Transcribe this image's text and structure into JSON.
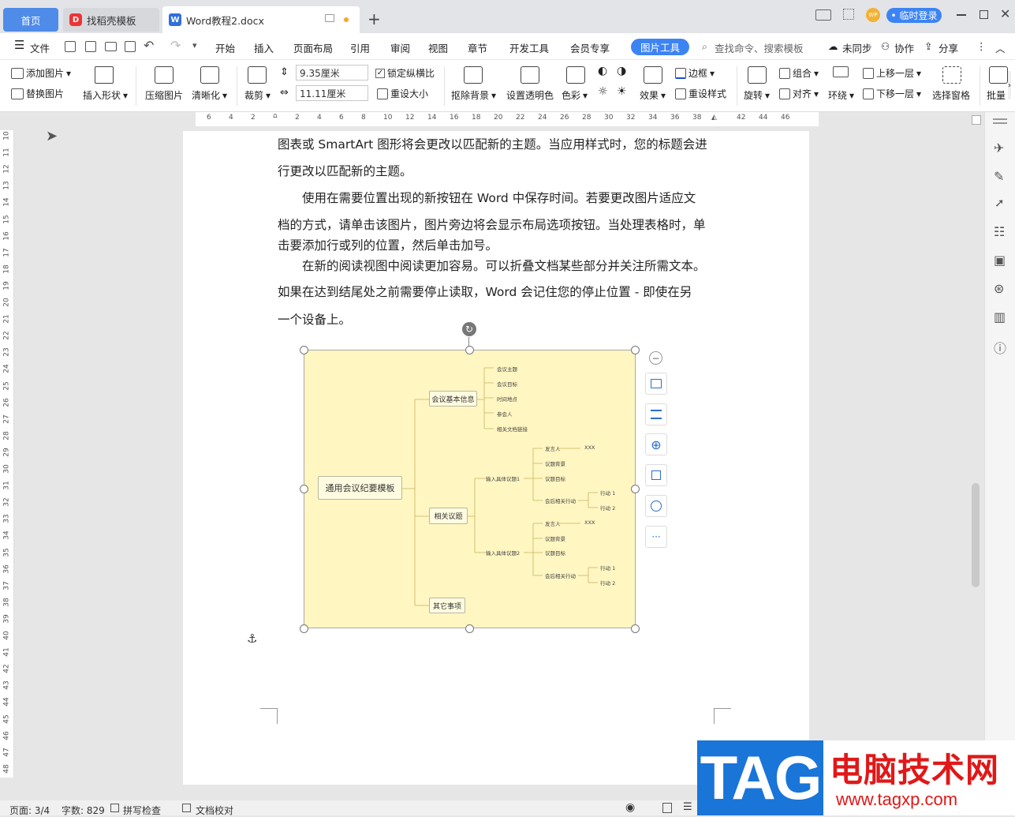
{
  "tabs": {
    "home": "首页",
    "template": "找稻壳模板",
    "doc": "Word教程2.docx"
  },
  "window": {
    "login": "• 临时登录",
    "badge": "WP"
  },
  "menu": {
    "file": "文件",
    "items": [
      "开始",
      "插入",
      "页面布局",
      "引用",
      "审阅",
      "视图",
      "章节",
      "开发工具",
      "会员专享"
    ],
    "active": "图片工具",
    "search": "查找命令、搜索模板",
    "sync": "未同步",
    "collab": "协作",
    "share": "分享"
  },
  "toolbar": {
    "add_image": "添加图片",
    "replace_image": "替换图片",
    "insert_shape": "插入形状",
    "compress": "压缩图片",
    "sharpen": "清晰化",
    "crop": "裁剪",
    "width": "9.35厘米",
    "height": "11.11厘米",
    "lock_ratio": "锁定纵横比",
    "reset_size": "重设大小",
    "remove_bg": "抠除背景",
    "transparent": "设置透明色",
    "color": "色彩",
    "effects": "效果",
    "border": "边框",
    "reset_style": "重设样式",
    "rotate": "旋转",
    "group": "组合",
    "align": "对齐",
    "wrap": "环绕",
    "bring_forward": "上移一层",
    "send_backward": "下移一层",
    "select_pane": "选择窗格",
    "batch": "批量"
  },
  "ruler": {
    "h": [
      "6",
      "4",
      "2",
      "",
      "2",
      "4",
      "6",
      "8",
      "10",
      "12",
      "14",
      "16",
      "18",
      "20",
      "22",
      "24",
      "26",
      "28",
      "30",
      "32",
      "34",
      "36",
      "38",
      "",
      "42",
      "44",
      "46"
    ],
    "v": [
      "10",
      "11",
      "12",
      "13",
      "14",
      "15",
      "16",
      "17",
      "18",
      "19",
      "20",
      "21",
      "22",
      "23",
      "24",
      "25",
      "26",
      "27",
      "28",
      "29",
      "30",
      "31",
      "32",
      "33",
      "34",
      "35",
      "36",
      "37",
      "38",
      "39",
      "40",
      "41",
      "42",
      "43",
      "44",
      "45",
      "46",
      "47",
      "48"
    ]
  },
  "doc": {
    "lines": [
      "图表或 SmartArt 图形将会更改以匹配新的主题。当应用样式时，您的标题会进",
      "行更改以匹配新的主题。",
      "　　使用在需要位置出现的新按钮在 Word 中保存时间。若要更改图片适应文",
      "档的方式，请单击该图片，图片旁边将会显示布局选项按钮。当处理表格时，单",
      "击要添加行或列的位置，然后单击加号。",
      "　　在新的阅读视图中阅读更加容易。可以折叠文档某些部分并关注所需文本。",
      "如果在达到结尾处之前需要停止读取，Word 会记住您的停止位置 - 即使在另",
      "一个设备上。"
    ]
  },
  "mindmap": {
    "root": "通用会议纪要模板",
    "b1": "会议基本信息",
    "b1_leaves": [
      "会议主题",
      "会议目标",
      "时间地点",
      "参会人",
      "相关文档链接"
    ],
    "b2": "相关议题",
    "b2_sub": [
      "输入具体议题1",
      "输入具体议题2"
    ],
    "sub_leaves": [
      "发言人",
      "议题背景",
      "议题目标",
      "会后相关行动"
    ],
    "xxx": "XXX",
    "actions": [
      "行动 1",
      "行动 2"
    ],
    "b3": "其它事项"
  },
  "status": {
    "page": "页面: 3/4",
    "words": "字数: 829",
    "spell": "拼写检查",
    "proof": "文档校对"
  },
  "watermark": {
    "tag": "TAG",
    "title": "电脑技术网",
    "url": "www.tagxp.com"
  },
  "colors": {
    "accent": "#3d84f3",
    "home_tab": "#4f8be8",
    "mind_bg": "#fff6c2",
    "watermark_blue": "#1a75d8",
    "watermark_red": "#e01818"
  }
}
